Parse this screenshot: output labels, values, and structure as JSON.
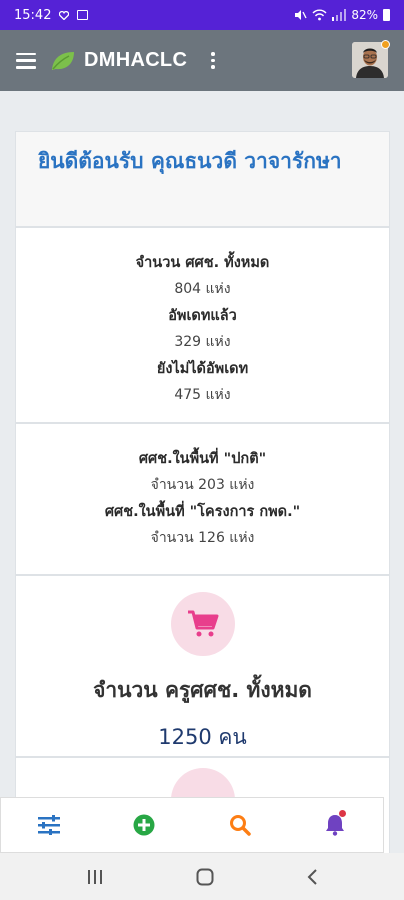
{
  "status_bar": {
    "time": "15:42",
    "battery": "82%"
  },
  "header": {
    "brand": "DMHACLC",
    "icons": {
      "menu": "hamburger-icon",
      "logo": "leaf-icon",
      "more": "kebab-icon",
      "avatar": "user-avatar"
    },
    "colors": {
      "header_bg": "#6c757d",
      "logo_green": "#7cc04b",
      "status_bar_bg": "#5522d6"
    }
  },
  "welcome": {
    "title": "ยินดีต้อนรับ คุณธนวดี วาจารักษา"
  },
  "summary_card": {
    "total_label": "จำนวน ศศช. ทั้งหมด",
    "total_value": "804 แห่ง",
    "updated_label": "อัพเดทแล้ว",
    "updated_value": "329 แห่ง",
    "not_updated_label": "ยังไม่ได้อัพเดท",
    "not_updated_value": "475 แห่ง"
  },
  "area_card": {
    "normal_label": "ศศช.ในพื้นที่ \"ปกติ\"",
    "normal_value": "จำนวน 203 แห่ง",
    "project_label": "ศศช.ในพื้นที่ \"โครงการ กพด.\"",
    "project_value": "จำนวน 126 แห่ง"
  },
  "teacher_card": {
    "icon": "shopping-cart-icon",
    "title": "จำนวน ครูศศช. ทั้งหมด",
    "count": "1250 คน",
    "colors": {
      "icon": "#e83e8c",
      "circle": "#f8dce6"
    }
  },
  "bottom_nav": {
    "items": [
      {
        "icon": "sliders-icon",
        "color": "#2a73c2"
      },
      {
        "icon": "plus-circle-icon",
        "color": "#28a745"
      },
      {
        "icon": "search-icon",
        "color": "#fd7e14"
      },
      {
        "icon": "bell-icon",
        "color": "#6f42c1"
      }
    ]
  }
}
